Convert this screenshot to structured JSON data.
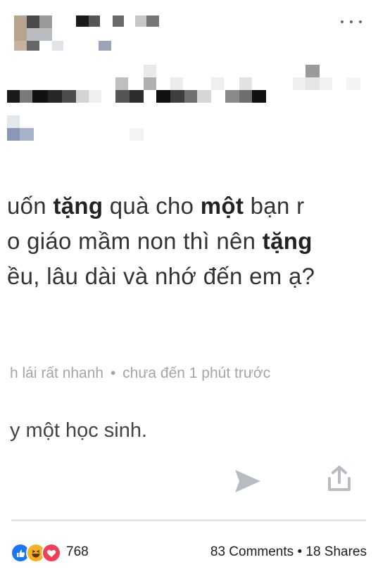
{
  "question": {
    "line1": {
      "a": "uốn ",
      "b1": "tặng",
      "c": " quà cho ",
      "b2": "một",
      "d": " bạn r"
    },
    "line2": {
      "a": "o giáo mầm non thì nên ",
      "b1": "tặng"
    },
    "line3": {
      "a": "ều, lâu dài và nhớ đến em ạ?"
    }
  },
  "meta": {
    "author": "h lái rất nhanh",
    "separator": "•",
    "time": "chưa đến 1 phút trước"
  },
  "reply_text": "y một học sinh.",
  "footer": {
    "reaction_count": "768",
    "comments": "83 Comments",
    "separator": "•",
    "shares": "18 Shares"
  },
  "icons": [
    "more-icon",
    "send-icon",
    "share-icon",
    "like-reaction-icon",
    "haha-reaction-icon",
    "love-reaction-icon"
  ],
  "colors": {
    "like": "#1877f2",
    "haha": "#f7b125",
    "love": "#f33e58",
    "action_icon": "#b8bdc4"
  }
}
